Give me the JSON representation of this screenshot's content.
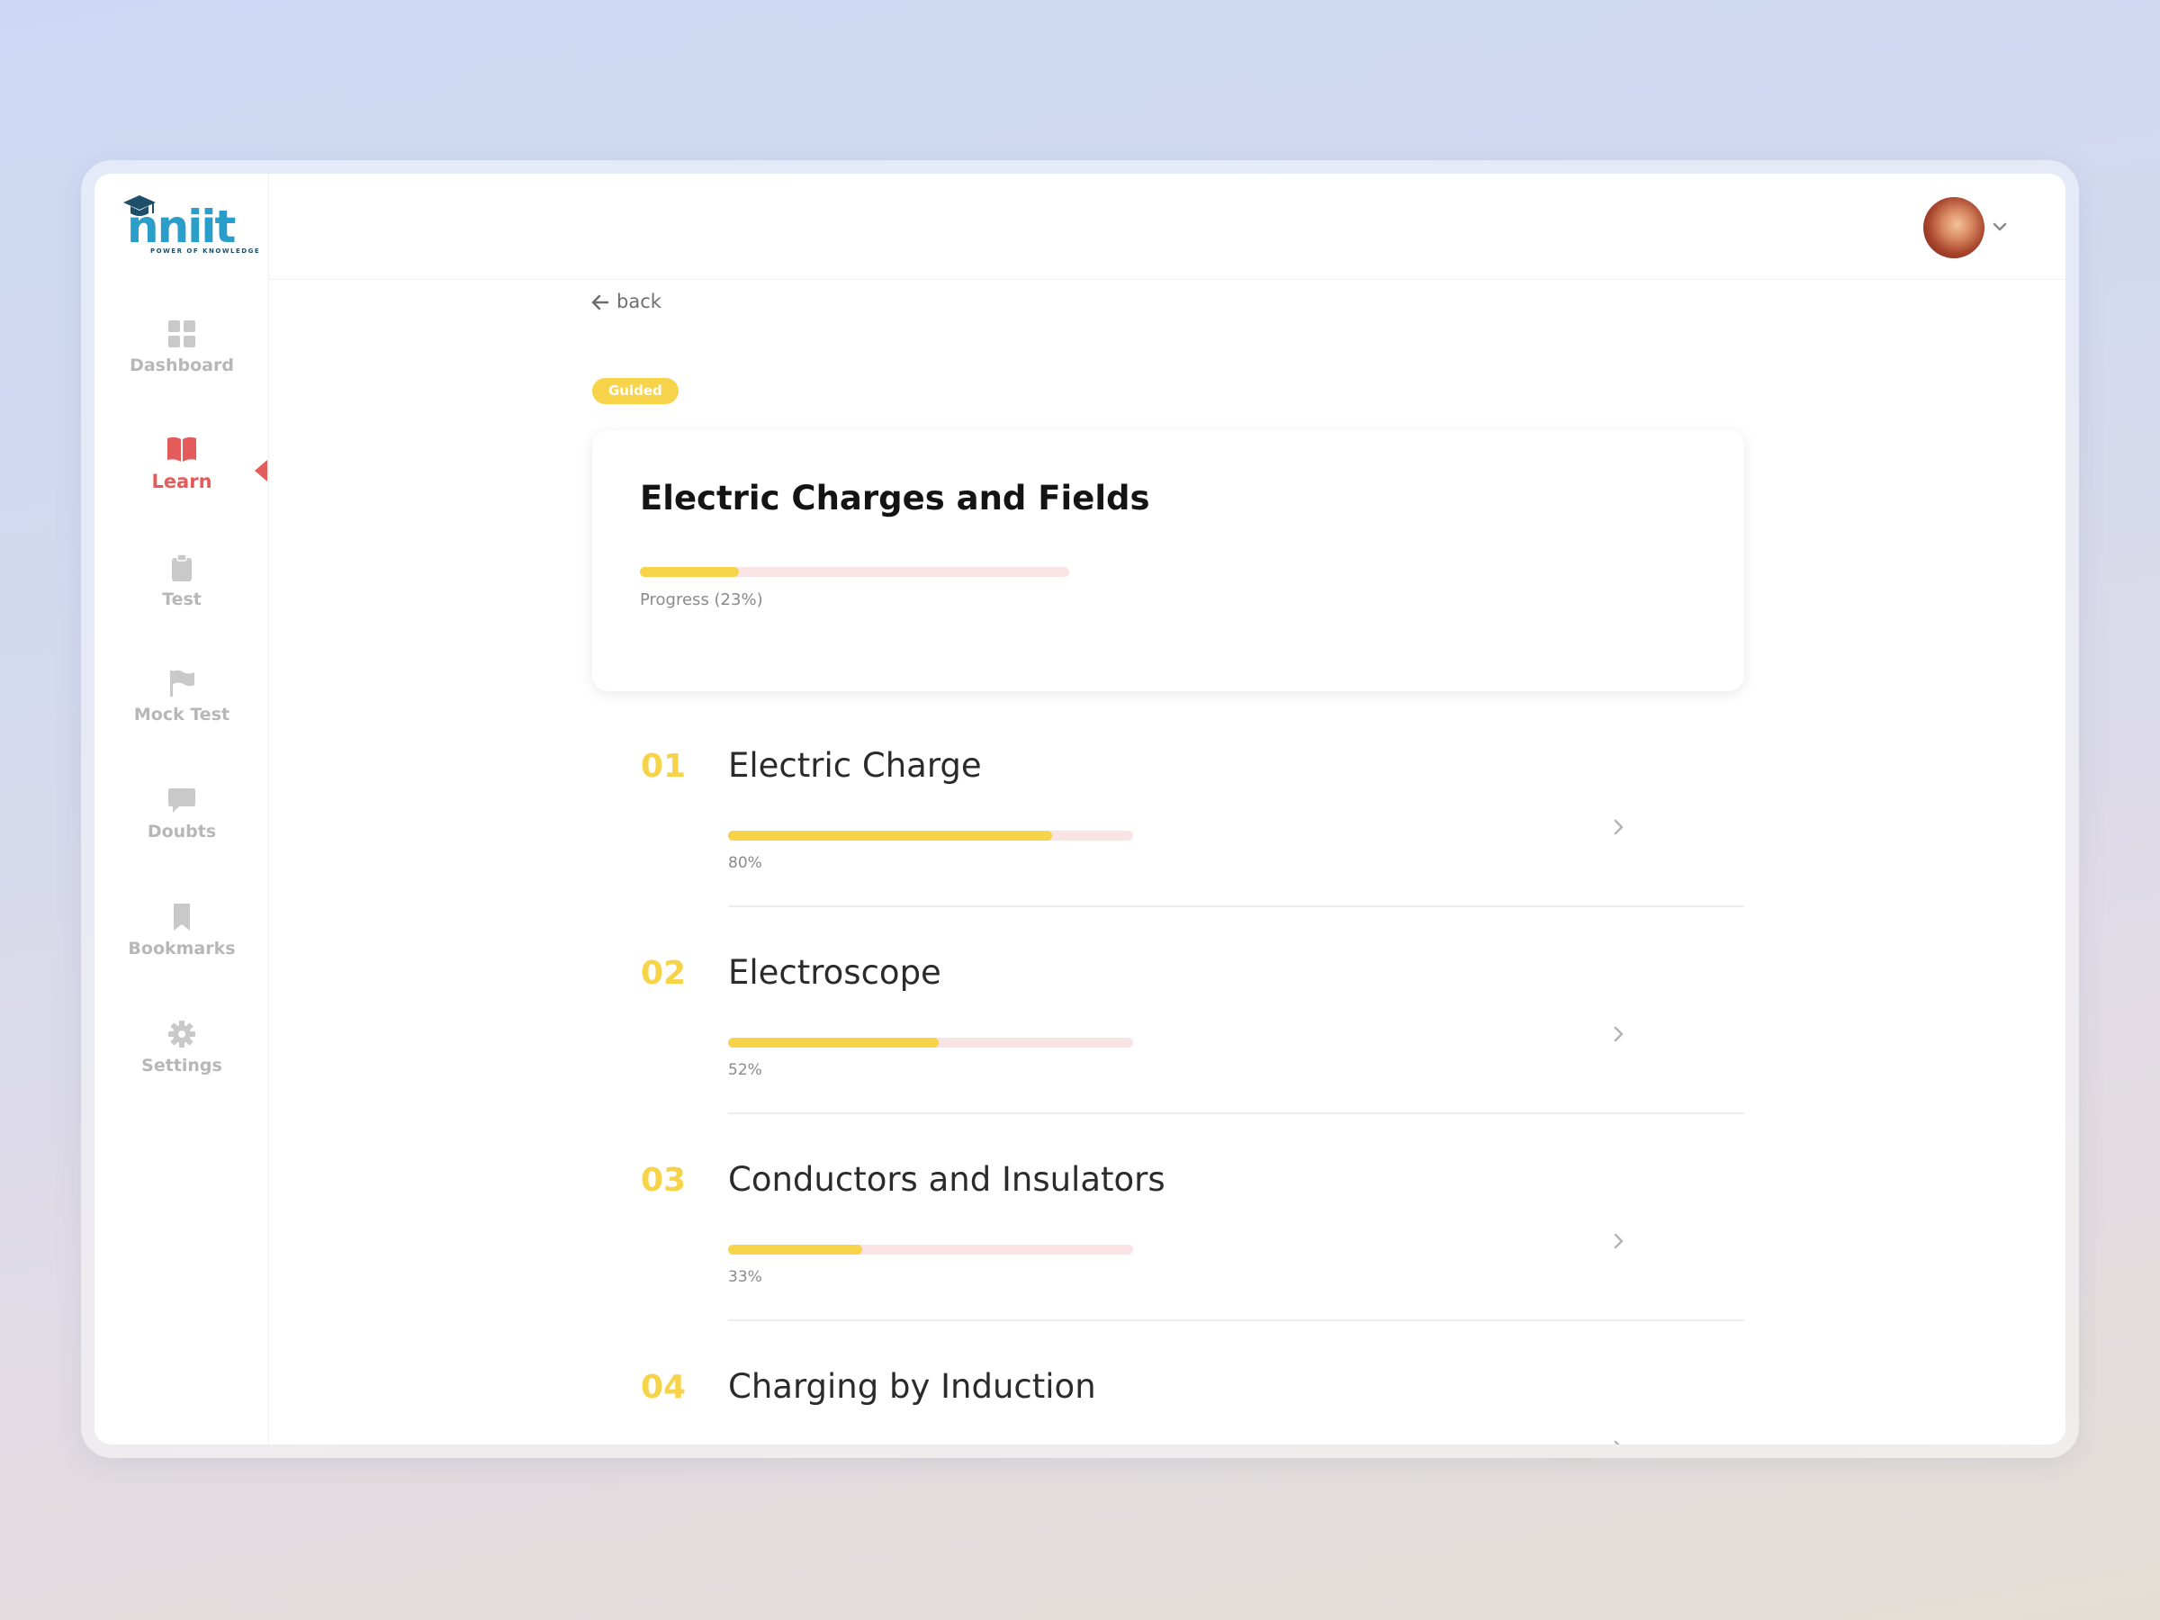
{
  "brand": {
    "logo_text": "nniit",
    "tagline": "POWER OF KNOWLEDGE",
    "accent": "#f7d34a",
    "active_color": "#e45b5b"
  },
  "sidebar": {
    "items": [
      {
        "label": "Dashboard",
        "icon": "grid-icon"
      },
      {
        "label": "Learn",
        "icon": "book-icon",
        "active": true
      },
      {
        "label": "Test",
        "icon": "clipboard-icon"
      },
      {
        "label": "Mock Test",
        "icon": "flag-icon"
      },
      {
        "label": "Doubts",
        "icon": "chat-icon"
      },
      {
        "label": "Bookmarks",
        "icon": "bookmark-icon"
      },
      {
        "label": "Settings",
        "icon": "gear-icon"
      }
    ]
  },
  "header": {
    "avatar": "user-avatar",
    "menu_icon": "chevron-down-icon"
  },
  "nav": {
    "back_label": "back"
  },
  "course": {
    "badge": "Guided",
    "title": "Electric Charges and Fields",
    "progress_fraction": 0.23,
    "progress_label": "Progress (23%)"
  },
  "chapters": [
    {
      "number": "01",
      "title": "Electric Charge",
      "progress_fraction": 0.8,
      "progress_label": "80%"
    },
    {
      "number": "02",
      "title": "Electroscope",
      "progress_fraction": 0.52,
      "progress_label": "52%"
    },
    {
      "number": "03",
      "title": "Conductors and Insulators",
      "progress_fraction": 0.33,
      "progress_label": "33%"
    },
    {
      "number": "04",
      "title": "Charging by Induction"
    }
  ]
}
